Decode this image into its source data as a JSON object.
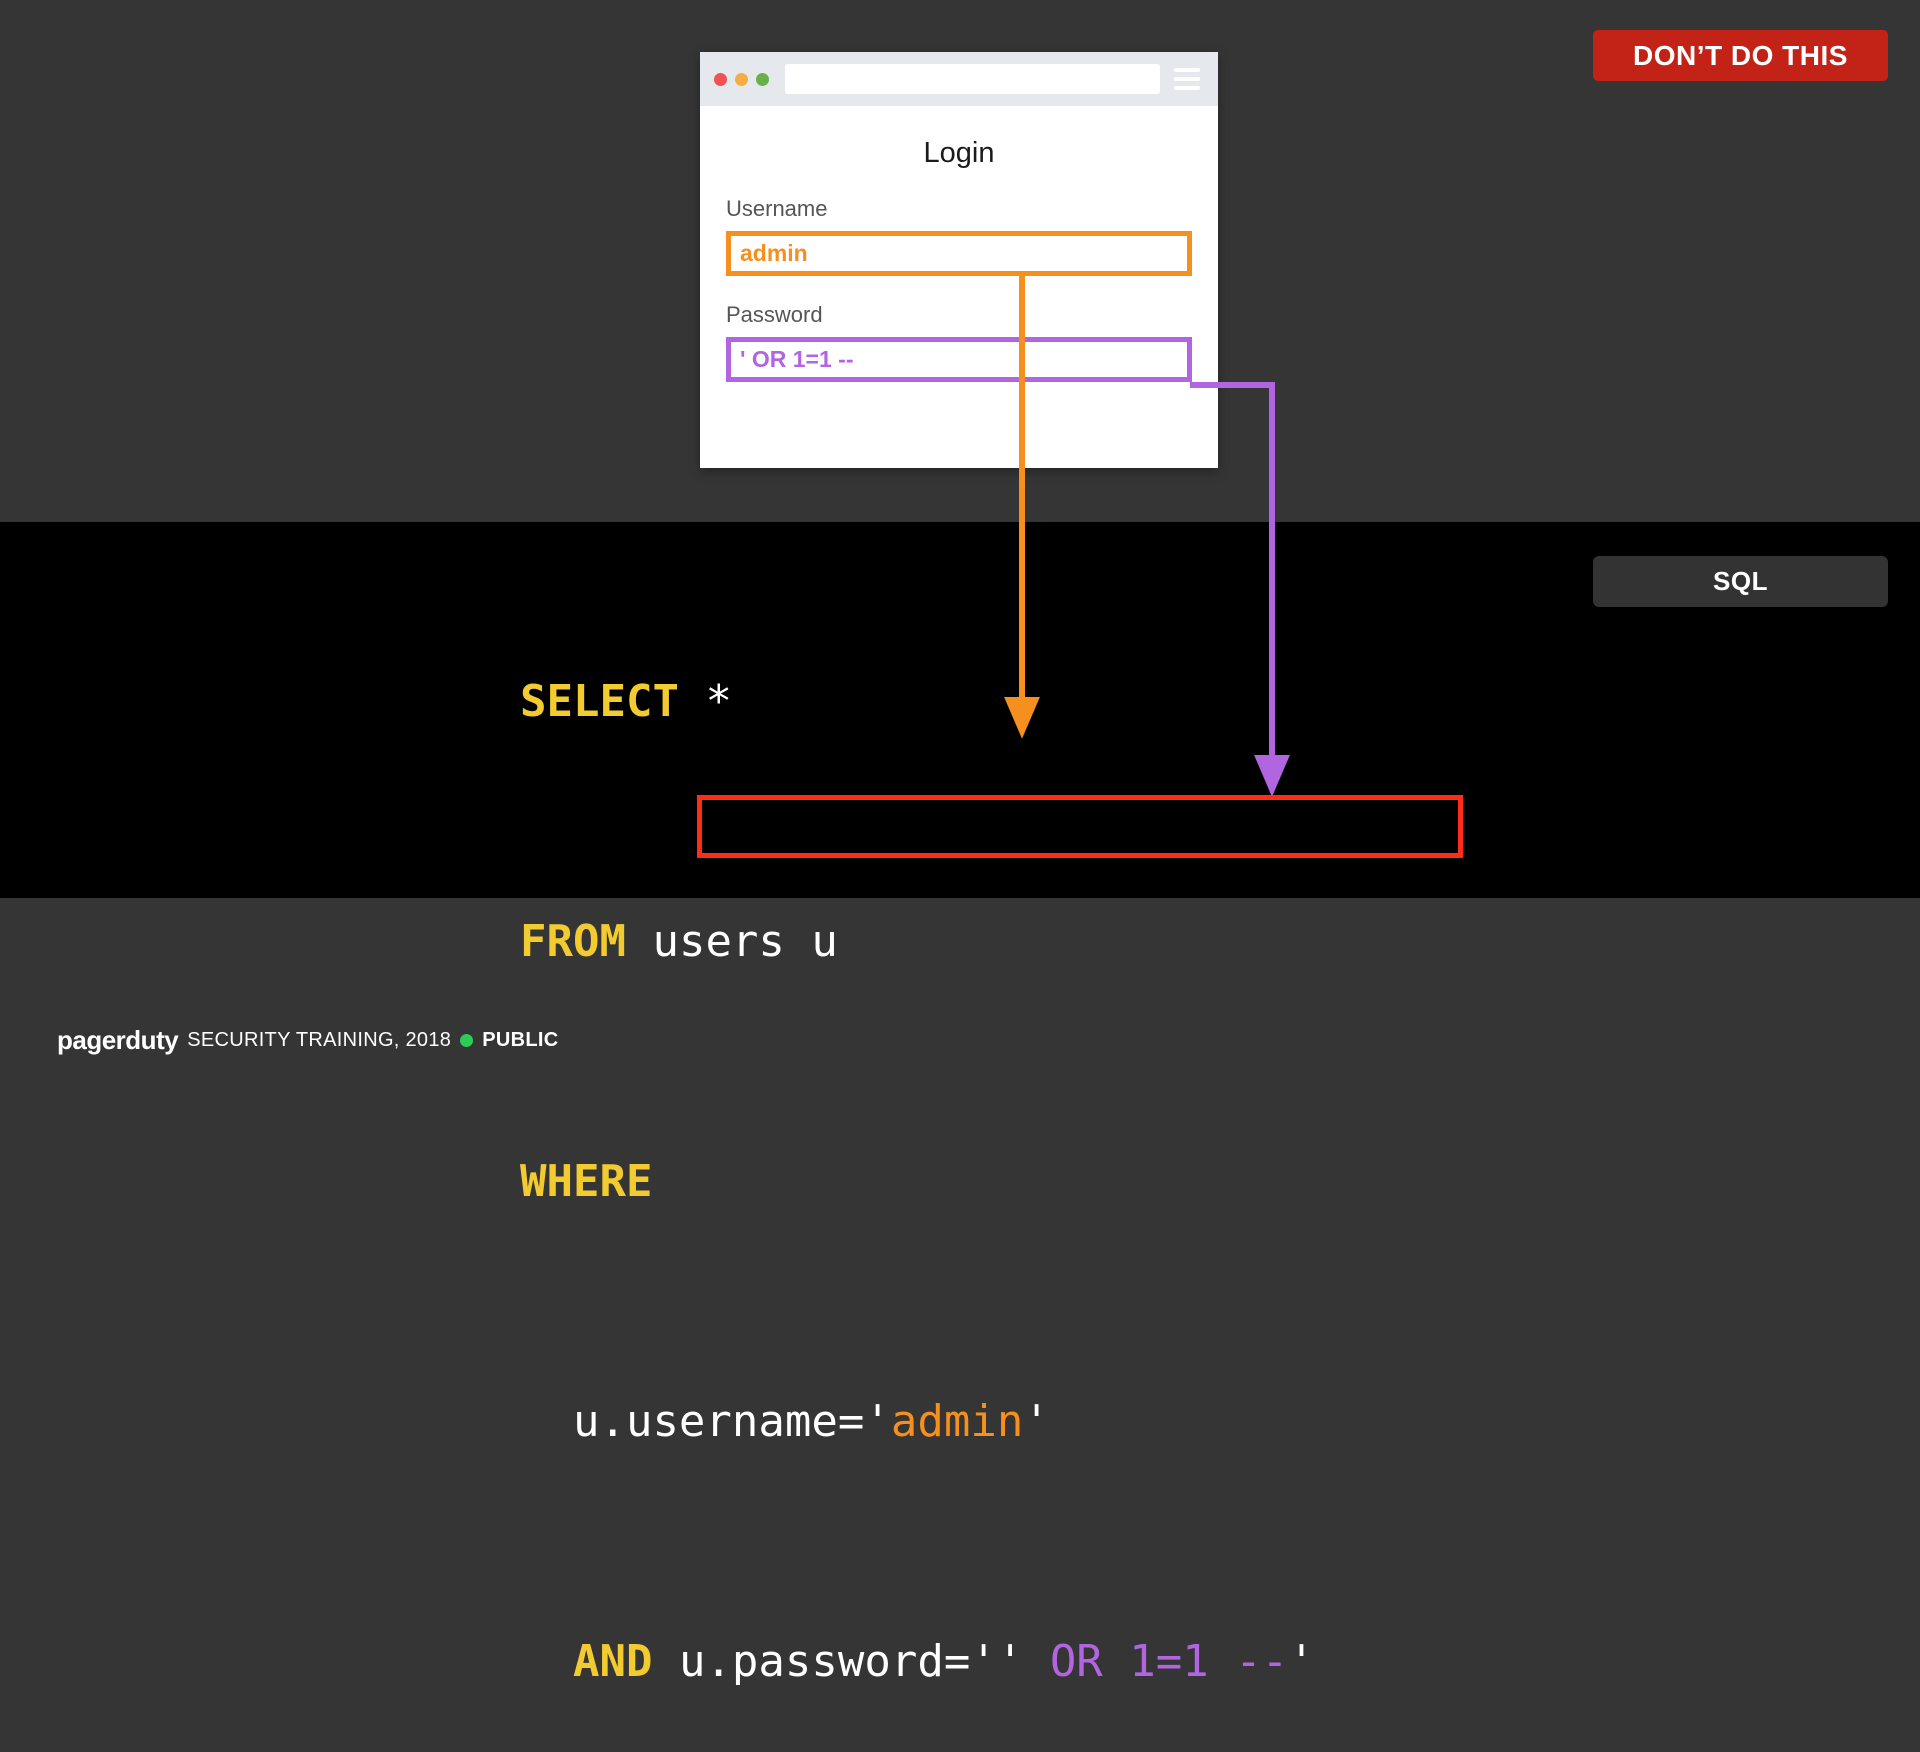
{
  "slide": {
    "warning_badge": "DON’T DO THIS",
    "language_badge": "SQL"
  },
  "browser": {
    "url_value": "",
    "url_placeholder": "",
    "menu_icon": "hamburger-icon",
    "traffic_lights": [
      "close-dot",
      "minimize-dot",
      "maximize-dot"
    ],
    "login_form": {
      "title": "Login",
      "username_label": "Username",
      "username_value": "admin",
      "username_accent": "#F5901E",
      "password_label": "Password",
      "password_value": "' OR 1=1 --",
      "password_accent": "#B265E0"
    }
  },
  "sql": {
    "line1_keyword": "SELECT",
    "line1_rest": " *",
    "line2_keyword": "FROM",
    "line2_rest": " users u",
    "line3_keyword": "WHERE",
    "line4_text": "u.username='",
    "line4_injected": "admin",
    "line4_tail": "'",
    "line5_keyword": "AND",
    "line5_text": " u.password=''",
    "line5_injected": " OR 1=1 --",
    "line5_tail": "'",
    "keyword_color": "#F2CB30",
    "highlight_box_color": "#FF2D17"
  },
  "footer": {
    "brand": "pagerduty",
    "text": "SECURITY TRAINING, 2018",
    "classification": "PUBLIC",
    "classification_dot_color": "#2ECC57"
  }
}
